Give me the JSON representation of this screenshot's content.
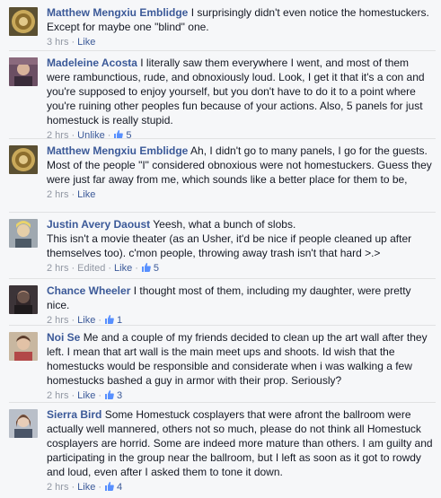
{
  "comments": [
    {
      "author": "Matthew Mengxiu Emblidge",
      "text": "I surprisingly didn't even notice the homestuckers. Except for maybe one \"blind\" one.",
      "time": "3 hrs",
      "like_label": "Like",
      "edited": "",
      "likes": "",
      "avatar_icon": "gold-emblem-avatar"
    },
    {
      "author": "Madeleine Acosta",
      "text": "I literally saw them everywhere I went, and most of them were rambunctious, rude, and obnoxiously loud. Look, I get it that it's a con and you're supposed to enjoy yourself, but you don't have to do it to a point where you're ruining other peoples fun because of your actions. Also, 5 panels for just homestuck is really stupid.",
      "time": "2 hrs",
      "like_label": "Unlike",
      "edited": "",
      "likes": "5",
      "avatar_icon": "photo-avatar"
    },
    {
      "author": "Matthew Mengxiu Emblidge",
      "text": "Ah, I didn't go to many panels, I go for the guests. Most of the people \"I\" considered obnoxious were not homestuckers. Guess they were just far away from me, which sounds like a better place for them to be,",
      "time": "2 hrs",
      "like_label": "Like",
      "edited": "",
      "likes": "",
      "avatar_icon": "gold-emblem-avatar"
    },
    {
      "author": "Justin Avery Daoust",
      "text": "Yeesh, what a bunch of slobs.\nThis isn't a movie theater (as an Usher, it'd be nice if people cleaned up after themselves too). c'mon people, throwing away trash isn't that hard >.>",
      "time": "2 hrs",
      "like_label": "Like",
      "edited": "Edited",
      "likes": "5",
      "avatar_icon": "photo-avatar"
    },
    {
      "author": "Chance Wheeler",
      "text": "I thought most of them, including my daughter, were pretty nice.",
      "time": "2 hrs",
      "like_label": "Like",
      "edited": "",
      "likes": "1",
      "avatar_icon": "photo-avatar"
    },
    {
      "author": "Noi Se",
      "text": "Me and a couple of my friends decided to clean up the art wall after they left. I mean that art wall is the main meet ups and shoots. Id wish that the homestucks would be responsible and considerate when i was walking a few homestucks bashed a guy in armor with their prop. Seriously?",
      "time": "2 hrs",
      "like_label": "Like",
      "edited": "",
      "likes": "3",
      "avatar_icon": "photo-avatar"
    },
    {
      "author": "Sierra Bird",
      "text": "Some Homestuck cosplayers that were afront the ballroom were actually well mannered, others not so much, please do not think all Homestuck cosplayers are horrid. Some are indeed more mature than others. I am guilty and participating in the group near the ballroom, but I left as soon as it got to rowdy and loud, even after I asked them to tone it down.",
      "time": "2 hrs",
      "like_label": "Like",
      "edited": "",
      "likes": "4",
      "avatar_icon": "photo-avatar"
    }
  ],
  "colors": {
    "link": "#3b5998",
    "meta": "#9197a3",
    "background": "#f6f7f9",
    "like_icon": "#5890ff"
  }
}
